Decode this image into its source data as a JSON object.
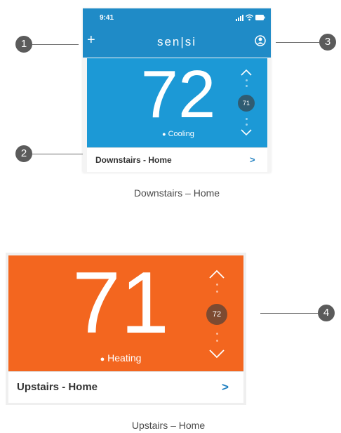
{
  "callouts": [
    "1",
    "2",
    "3",
    "4"
  ],
  "top_screen": {
    "status_time": "9:41",
    "brand": "sen|si",
    "add_label": "+",
    "temperature": "72",
    "setpoint": "71",
    "mode": "Cooling",
    "footer_label": "Downstairs - Home",
    "chevron": ">",
    "card_color": "#1c99d6",
    "bar_color": "#1f8bc7"
  },
  "top_caption": "Downstairs – Home",
  "bottom_screen": {
    "temperature": "71",
    "setpoint": "72",
    "mode": "Heating",
    "footer_label": "Upstairs - Home",
    "chevron": ">",
    "card_color": "#f3661f"
  },
  "bottom_caption": "Upstairs – Home"
}
